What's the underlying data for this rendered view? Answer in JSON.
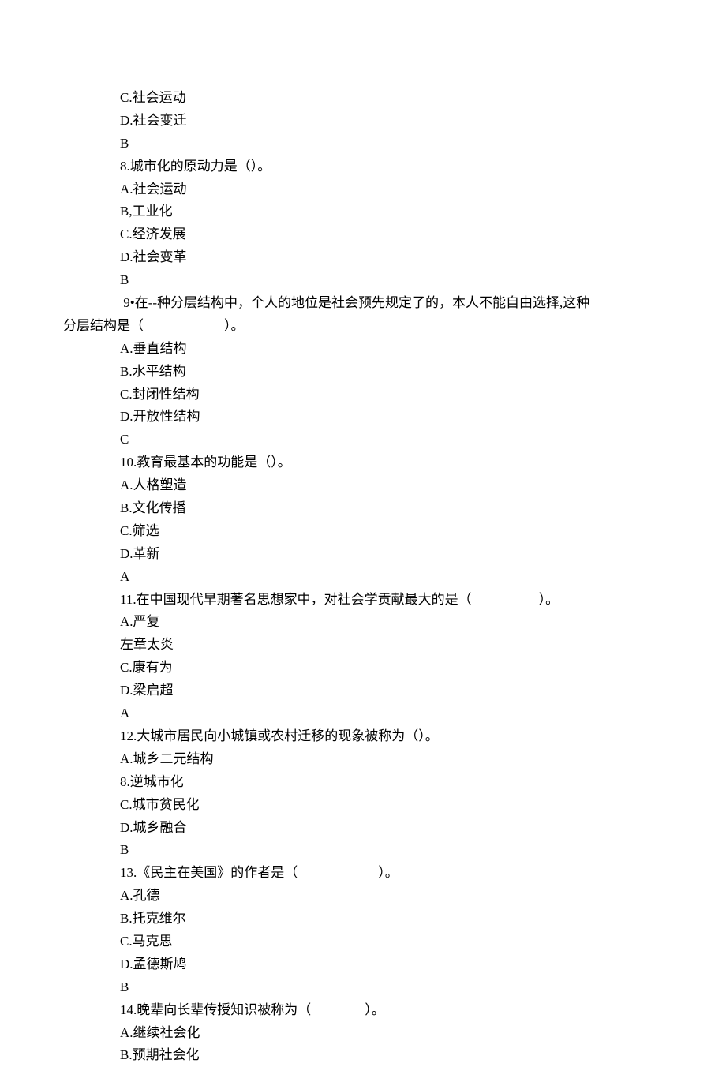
{
  "lines": [
    {
      "cls": "indent",
      "text": "C.社会运动"
    },
    {
      "cls": "indent",
      "text": "D.社会变迁"
    },
    {
      "cls": "indent",
      "text": "B"
    },
    {
      "cls": "indent",
      "text": "8.城市化的原动力是（）。"
    },
    {
      "cls": "indent",
      "text": "A.社会运动"
    },
    {
      "cls": "indent",
      "text": "B,工业化"
    },
    {
      "cls": "indent",
      "text": "C.经济发展"
    },
    {
      "cls": "indent",
      "text": "D.社会变革"
    },
    {
      "cls": "indent",
      "text": "B"
    },
    {
      "cls": "indent",
      "text": " 9•在--种分层结构中，个人的地位是社会预先规定了的，本人不能自由选择,这种"
    },
    {
      "cls": "no-indent",
      "text": "分层结构是（　　　　　　）。"
    },
    {
      "cls": "indent",
      "text": "A.垂直结构"
    },
    {
      "cls": "indent",
      "text": "B.水平结构"
    },
    {
      "cls": "indent",
      "text": "C.封闭性结构"
    },
    {
      "cls": "indent",
      "text": "D.开放性结构"
    },
    {
      "cls": "indent",
      "text": "C"
    },
    {
      "cls": "indent",
      "text": "10.教育最基本的功能是（）。"
    },
    {
      "cls": "indent",
      "text": "A.人格塑造"
    },
    {
      "cls": "indent",
      "text": "B.文化传播"
    },
    {
      "cls": "indent",
      "text": "C.筛选"
    },
    {
      "cls": "indent",
      "text": "D.革新"
    },
    {
      "cls": "indent",
      "text": "A"
    },
    {
      "cls": "indent",
      "text": "11.在中国现代早期著名思想家中，对社会学贡献最大的是（　　　　　）。"
    },
    {
      "cls": "indent",
      "text": "A.严复"
    },
    {
      "cls": "indent",
      "text": "左章太炎"
    },
    {
      "cls": "indent",
      "text": "C.康有为"
    },
    {
      "cls": "indent",
      "text": "D.梁启超"
    },
    {
      "cls": "indent",
      "text": "A"
    },
    {
      "cls": "indent",
      "text": "12.大城市居民向小城镇或农村迁移的现象被称为（）。"
    },
    {
      "cls": "indent",
      "text": "A.城乡二元结构"
    },
    {
      "cls": "indent",
      "text": "8.逆城市化"
    },
    {
      "cls": "indent",
      "text": "C.城市贫民化"
    },
    {
      "cls": "indent",
      "text": "D.城乡融合"
    },
    {
      "cls": "indent",
      "text": "B"
    },
    {
      "cls": "indent",
      "text": "13.《民主在美国》的作者是（　　　　　　）。"
    },
    {
      "cls": "indent",
      "text": "A.孔德"
    },
    {
      "cls": "indent",
      "text": "B.托克维尔"
    },
    {
      "cls": "indent",
      "text": "C.马克思"
    },
    {
      "cls": "indent",
      "text": "D.孟德斯鸠"
    },
    {
      "cls": "indent",
      "text": "B"
    },
    {
      "cls": "indent",
      "text": "14.晚辈向长辈传授知识被称为（　　　　）。"
    },
    {
      "cls": "indent",
      "text": "A.继续社会化"
    },
    {
      "cls": "indent",
      "text": "B.预期社会化"
    }
  ]
}
